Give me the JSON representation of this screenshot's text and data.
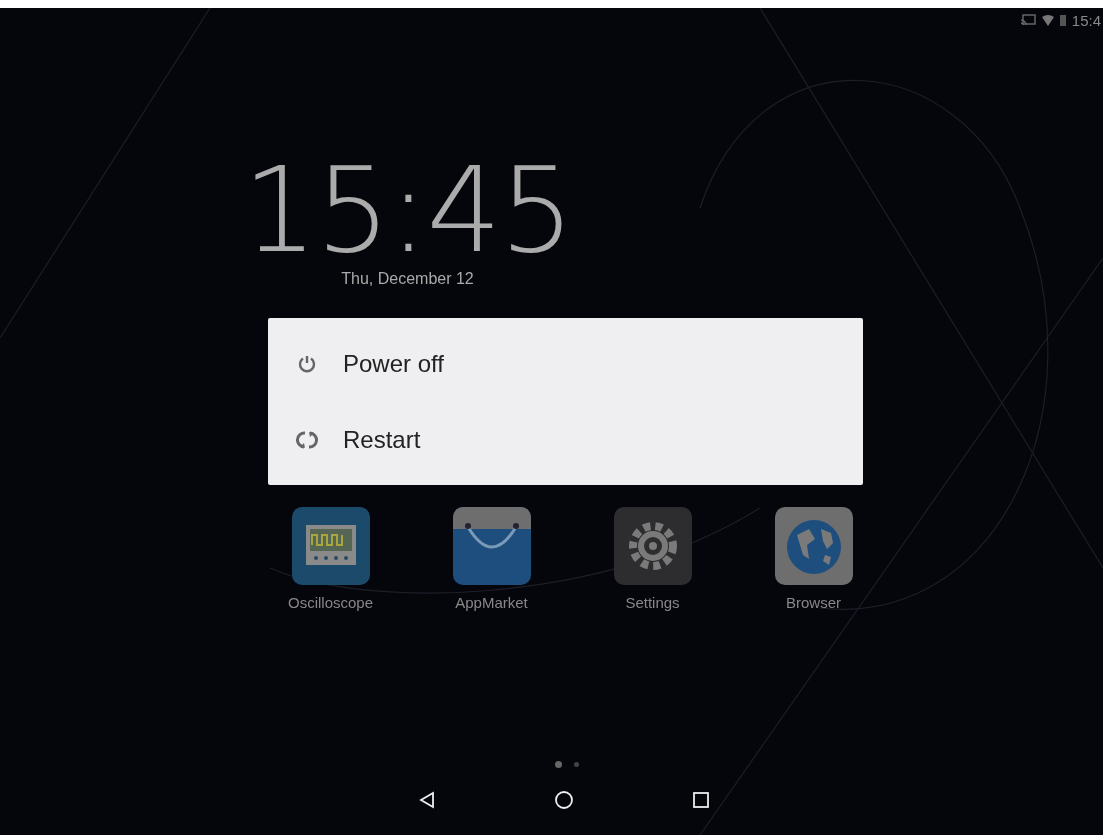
{
  "status_bar": {
    "time": "15:4"
  },
  "lock_clock": {
    "time": "15:45",
    "date": "Thu, December 12"
  },
  "power_menu": {
    "items": [
      {
        "kind": "power",
        "label": "Power off"
      },
      {
        "kind": "restart",
        "label": "Restart"
      }
    ]
  },
  "apps": [
    {
      "kind": "oscilloscope",
      "label": "Oscilloscope"
    },
    {
      "kind": "market",
      "label": "AppMarket"
    },
    {
      "kind": "settings",
      "label": "Settings"
    },
    {
      "kind": "browser",
      "label": "Browser"
    }
  ],
  "pages": [
    {
      "selected": true
    },
    {
      "selected": false
    }
  ]
}
